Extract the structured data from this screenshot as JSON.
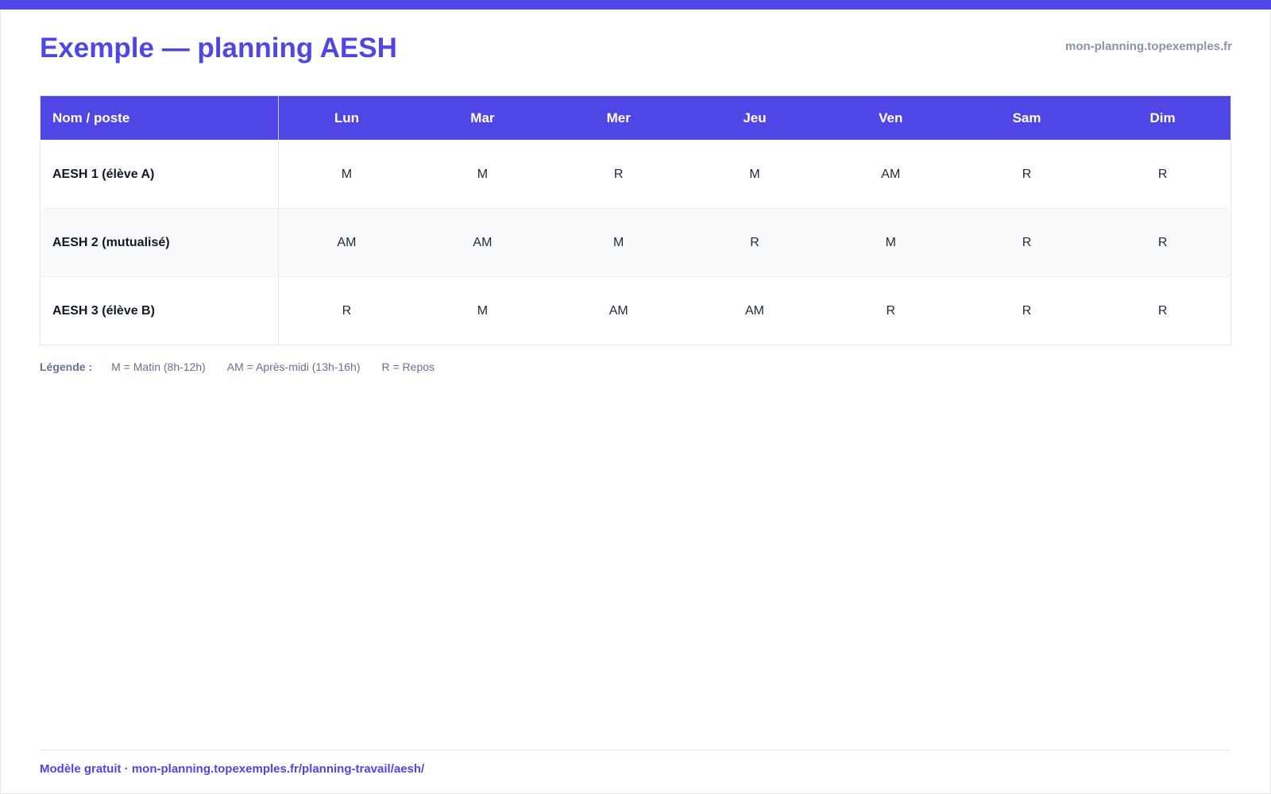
{
  "header": {
    "title": "Exemple — planning AESH",
    "site": "mon-planning.topexemples.fr"
  },
  "table": {
    "name_header": "Nom / poste",
    "days": [
      "Lun",
      "Mar",
      "Mer",
      "Jeu",
      "Ven",
      "Sam",
      "Dim"
    ],
    "rows": [
      {
        "name": "AESH 1 (élève A)",
        "cells": [
          "M",
          "M",
          "R",
          "M",
          "AM",
          "R",
          "R"
        ]
      },
      {
        "name": "AESH 2 (mutualisé)",
        "cells": [
          "AM",
          "AM",
          "M",
          "R",
          "M",
          "R",
          "R"
        ]
      },
      {
        "name": "AESH 3 (élève B)",
        "cells": [
          "R",
          "M",
          "AM",
          "AM",
          "R",
          "R",
          "R"
        ]
      }
    ]
  },
  "legend": {
    "label": "Légende :",
    "items": [
      "M = Matin (8h-12h)",
      "AM = Après-midi (13h-16h)",
      "R = Repos"
    ]
  },
  "footer": {
    "text": "Modèle gratuit · mon-planning.topexemples.fr/planning-travail/aesh/"
  },
  "colors": {
    "accent": "#4f46e5",
    "muted": "#8a94a6"
  }
}
